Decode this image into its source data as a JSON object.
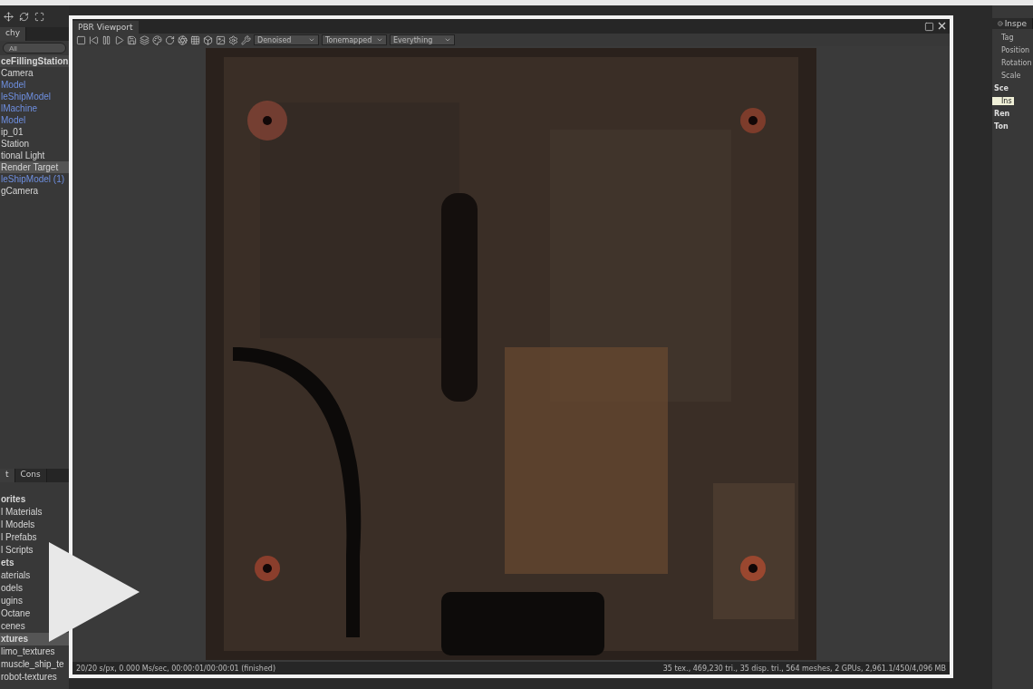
{
  "hierarchy": {
    "tab": "chy",
    "search_placeholder": "All",
    "items": [
      {
        "label": "ceFillingStation",
        "kind": "scene",
        "selected": false
      },
      {
        "label": "Camera",
        "kind": "object",
        "selected": false
      },
      {
        "label": "Model",
        "kind": "prefab",
        "selected": false
      },
      {
        "label": "leShipModel",
        "kind": "prefab",
        "selected": false
      },
      {
        "label": "lMachine",
        "kind": "prefab",
        "selected": false
      },
      {
        "label": "Model",
        "kind": "prefab",
        "selected": false
      },
      {
        "label": "ip_01",
        "kind": "object",
        "selected": false
      },
      {
        "label": "Station",
        "kind": "object",
        "selected": false
      },
      {
        "label": "tional Light",
        "kind": "object",
        "selected": false
      },
      {
        "label": "Render Target",
        "kind": "object",
        "selected": true
      },
      {
        "label": "leShipModel (1)",
        "kind": "prefab",
        "selected": false
      },
      {
        "label": "gCamera",
        "kind": "object",
        "selected": false
      }
    ]
  },
  "project": {
    "tabs": [
      {
        "label": "t",
        "selected": true
      },
      {
        "label": "Cons",
        "selected": false
      }
    ],
    "items": [
      {
        "label": "orites",
        "kind": "section",
        "selected": false
      },
      {
        "label": "l Materials",
        "kind": "entry",
        "selected": false
      },
      {
        "label": "l Models",
        "kind": "entry",
        "selected": false
      },
      {
        "label": "l Prefabs",
        "kind": "entry",
        "selected": false
      },
      {
        "label": "l Scripts",
        "kind": "entry",
        "selected": false
      },
      {
        "label": "ets",
        "kind": "section",
        "selected": false
      },
      {
        "label": "aterials",
        "kind": "entry",
        "selected": false
      },
      {
        "label": "odels",
        "kind": "entry",
        "selected": false
      },
      {
        "label": "ugins",
        "kind": "entry",
        "selected": false
      },
      {
        "label": "Octane",
        "kind": "entry",
        "selected": false
      },
      {
        "label": "cenes",
        "kind": "entry",
        "selected": false
      },
      {
        "label": "xtures",
        "kind": "section",
        "selected": true
      },
      {
        "label": "limo_textures",
        "kind": "entry",
        "selected": false
      },
      {
        "label": "muscle_ship_te",
        "kind": "entry",
        "selected": false
      },
      {
        "label": "robot-textures",
        "kind": "entry",
        "selected": false
      }
    ]
  },
  "viewport": {
    "title": "PBR Viewport",
    "dropdowns": [
      "Denoised",
      "Tonemapped",
      "Everything"
    ],
    "status_left": "20/20 s/px, 0.000 Ms/sec, 00:00:01/00:00:01 (finished)",
    "status_right": "35 tex., 469,230 tri., 35 disp. tri., 564 meshes, 2 GPUs, 2,961.1/450/4,096 MB"
  },
  "inspector": {
    "tab": "Inspe",
    "labels": [
      {
        "label": "Tag",
        "kind": "field"
      },
      {
        "label": "Position",
        "kind": "field"
      },
      {
        "label": "Rotation",
        "kind": "field"
      },
      {
        "label": "Scale",
        "kind": "field"
      },
      {
        "label": "Sce",
        "kind": "heading"
      },
      {
        "label": "Ins",
        "kind": "tooltip"
      },
      {
        "label": "Ren",
        "kind": "heading"
      },
      {
        "label": "Ton",
        "kind": "heading"
      }
    ]
  }
}
